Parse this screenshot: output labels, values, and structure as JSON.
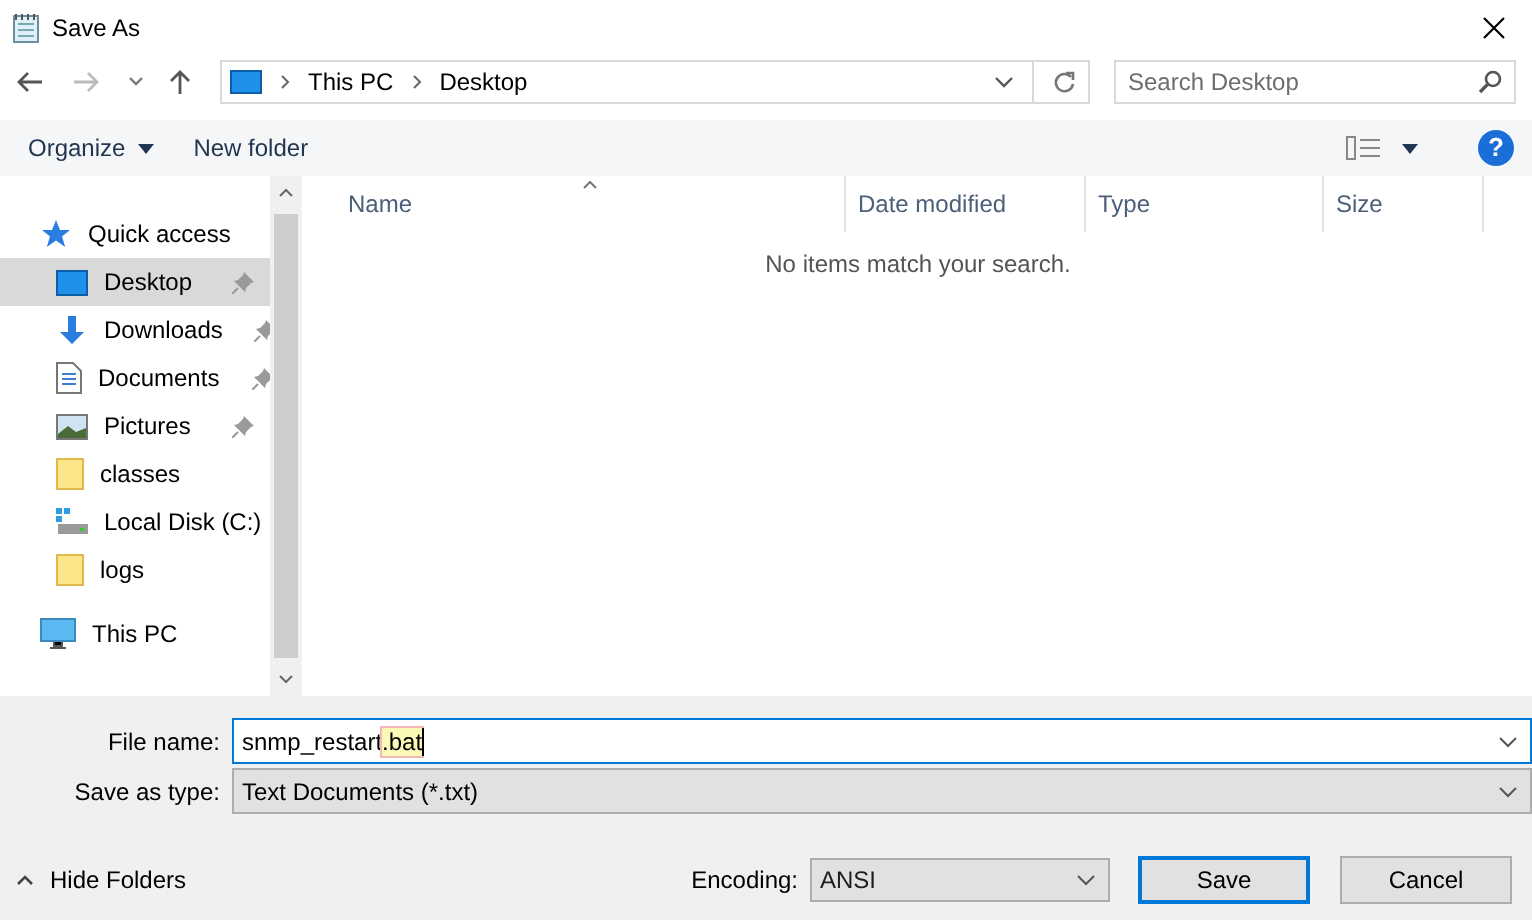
{
  "window": {
    "title": "Save As"
  },
  "address_bar": {
    "crumbs": [
      "This PC",
      "Desktop"
    ]
  },
  "search": {
    "placeholder": "Search Desktop"
  },
  "toolbar": {
    "organize": "Organize",
    "new_folder": "New folder",
    "help": "?"
  },
  "sidebar": {
    "items": [
      {
        "label": "Quick access",
        "kind": "star",
        "selected": false,
        "children": [
          {
            "label": "Desktop",
            "kind": "desktop",
            "selected": true,
            "pinned": true
          },
          {
            "label": "Downloads",
            "kind": "download",
            "selected": false,
            "pinned": true
          },
          {
            "label": "Documents",
            "kind": "document",
            "selected": false,
            "pinned": true
          },
          {
            "label": "Pictures",
            "kind": "picture",
            "selected": false,
            "pinned": true
          },
          {
            "label": "classes",
            "kind": "folder",
            "selected": false,
            "pinned": false
          },
          {
            "label": "Local Disk (C:)",
            "kind": "drive",
            "selected": false,
            "pinned": false
          },
          {
            "label": "logs",
            "kind": "folder",
            "selected": false,
            "pinned": false
          }
        ]
      },
      {
        "label": "This PC",
        "kind": "pc",
        "selected": false
      }
    ]
  },
  "table": {
    "columns": [
      "Name",
      "Date modified",
      "Type",
      "Size"
    ],
    "empty_message": "No items match your search."
  },
  "form": {
    "file_name_label": "File name:",
    "file_name_parts": [
      {
        "text": "snmp_restart",
        "highlighted": false
      },
      {
        "text": ".bat",
        "highlighted": true
      }
    ],
    "type_label": "Save as type:",
    "type_value": "Text Documents (*.txt)"
  },
  "footer": {
    "hide_folders": "Hide Folders",
    "encoding_label": "Encoding:",
    "encoding_value": "ANSI",
    "buttons": [
      {
        "label": "Save",
        "default": true
      },
      {
        "label": "Cancel",
        "default": false
      }
    ]
  }
}
